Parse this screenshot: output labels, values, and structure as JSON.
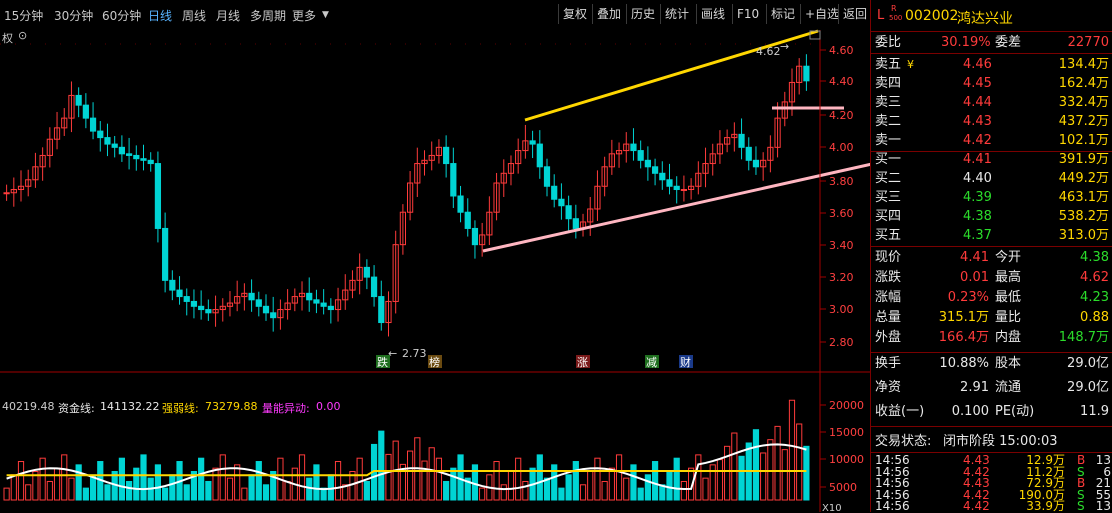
{
  "toolbar": {
    "periods": [
      "15分钟",
      "30分钟",
      "60分钟",
      "日线",
      "周线",
      "月线",
      "多周期",
      "更多"
    ],
    "tools": [
      "复权",
      "叠加",
      "历史",
      "统计",
      "画线",
      "F10",
      "标记",
      "+自选",
      "返回"
    ],
    "quan_label": "权"
  },
  "price_axis": [
    "4.60",
    "4.40",
    "4.20",
    "4.00",
    "3.80",
    "3.60",
    "3.40",
    "3.20",
    "3.00",
    "2.80"
  ],
  "vol_axis": [
    "20000",
    "15000",
    "10000",
    "5000"
  ],
  "vol_unit": "X10",
  "annotations": {
    "high": "4.62",
    "low": "2.73"
  },
  "event_tags": [
    "跌",
    "榜",
    "涨",
    "减",
    "财"
  ],
  "indicator": {
    "lead": "40219.48",
    "fund_label": "资金线:",
    "fund_value": "141132.22",
    "strength_label": "强弱线:",
    "strength_value": "73279.88",
    "abnormal_label": "量能异动:",
    "abnormal_value": "0.00"
  },
  "stock": {
    "code": "002002",
    "name": "鸿达兴业",
    "badge_l": "L",
    "badge_r": "R",
    "badge_500": "500"
  },
  "quote": {
    "weibi_label": "委比",
    "weibi": "30.19%",
    "weicha_label": "委差",
    "weicha": "22770",
    "sells": [
      {
        "label": "卖五",
        "mark": "¥",
        "price": "4.46",
        "vol": "134.4万"
      },
      {
        "label": "卖四",
        "mark": "",
        "price": "4.45",
        "vol": "162.4万"
      },
      {
        "label": "卖三",
        "mark": "",
        "price": "4.44",
        "vol": "332.4万"
      },
      {
        "label": "卖二",
        "mark": "",
        "price": "4.43",
        "vol": "437.2万"
      },
      {
        "label": "卖一",
        "mark": "",
        "price": "4.42",
        "vol": "102.1万"
      }
    ],
    "buys": [
      {
        "label": "买一",
        "price": "4.41",
        "vol": "391.9万"
      },
      {
        "label": "买二",
        "price": "4.40",
        "vol": "449.2万"
      },
      {
        "label": "买三",
        "price": "4.39",
        "vol": "463.1万"
      },
      {
        "label": "买四",
        "price": "4.38",
        "vol": "538.2万"
      },
      {
        "label": "买五",
        "price": "4.37",
        "vol": "313.0万"
      }
    ],
    "stats": [
      {
        "l1": "现价",
        "v1": "4.41",
        "c1": "red",
        "l2": "今开",
        "v2": "4.38",
        "c2": "green"
      },
      {
        "l1": "涨跌",
        "v1": "0.01",
        "c1": "red",
        "l2": "最高",
        "v2": "4.62",
        "c2": "red"
      },
      {
        "l1": "涨幅",
        "v1": "0.23%",
        "c1": "red",
        "l2": "最低",
        "v2": "4.23",
        "c2": "green"
      },
      {
        "l1": "总量",
        "v1": "315.1万",
        "c1": "yellow",
        "l2": "量比",
        "v2": "0.88",
        "c2": "yellow"
      },
      {
        "l1": "外盘",
        "v1": "166.4万",
        "c1": "red",
        "l2": "内盘",
        "v2": "148.7万",
        "c2": "green"
      }
    ],
    "fund": [
      {
        "l1": "换手",
        "v1": "10.88%",
        "l2": "股本",
        "v2": "29.0亿"
      },
      {
        "l1": "净资",
        "v1": "2.91",
        "l2": "流通",
        "v2": "29.0亿"
      },
      {
        "l1": "收益(一)",
        "v1": "0.100",
        "l2": "PE(动)",
        "v2": "11.9"
      }
    ],
    "status_label": "交易状态:",
    "status_value": "闭市阶段 15:00:03",
    "ticks": [
      {
        "time": "14:56",
        "price": "4.43",
        "vol": "12.9万",
        "side": "B",
        "count": "13"
      },
      {
        "time": "14:56",
        "price": "4.42",
        "vol": "11.2万",
        "side": "S",
        "count": "6"
      },
      {
        "time": "14:56",
        "price": "4.43",
        "vol": "72.9万",
        "side": "B",
        "count": "21"
      },
      {
        "time": "14:56",
        "price": "4.42",
        "vol": "190.0万",
        "side": "S",
        "count": "55"
      },
      {
        "time": "14:56",
        "price": "4.42",
        "vol": "33.9万",
        "side": "S",
        "count": "13"
      }
    ]
  },
  "colors": {
    "up": "#ff3b3b",
    "down": "#00d4d4",
    "ma_white": "#ffffff",
    "ma_yellow": "#ffd700",
    "trend_pink": "#ffb6c1",
    "ind_green": "#2bdc2b"
  }
}
